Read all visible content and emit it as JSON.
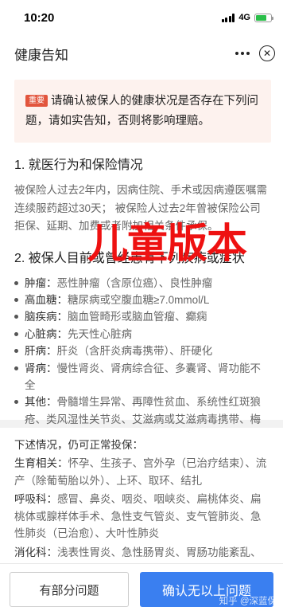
{
  "status": {
    "time": "10:20",
    "network": "4G"
  },
  "nav": {
    "title": "健康告知"
  },
  "notice": {
    "badge": "重要",
    "text": "请确认被保人的健康状况是否存在下列问题，请如实告知，否则将影响理赔。"
  },
  "section1": {
    "title": "1. 就医行为和保险情况",
    "text": "被保险人过去2年内，因病住院、手术或因病遵医嘱需连续服药超过30天； 被保险人过去2年曾被保险公司拒保、延期、加费或者附加相关条件承保。"
  },
  "section2": {
    "title": "2. 被保人目前或曾经患有下列疾病或症状",
    "items": [
      {
        "label": "肿瘤：",
        "text": "恶性肿瘤（含原位癌）、良性肿瘤"
      },
      {
        "label": "高血糖：",
        "text": "糖尿病或空腹血糖≥7.0mmol/L"
      },
      {
        "label": "脑疾病：",
        "text": "脑血管畸形或脑血管瘤、癫痫"
      },
      {
        "label": "心脏病：",
        "text": "先天性心脏病"
      },
      {
        "label": "肝病：",
        "text": "肝炎（含肝炎病毒携带）、肝硬化"
      },
      {
        "label": "肾病：",
        "text": "慢性肾炎、肾病综合征、多囊肾、肾功能不全"
      },
      {
        "label": "其他：",
        "text": "骨髓增生异常、再障性贫血、系统性红斑狼疮、类风湿性关节炎、艾滋病或艾滋病毒携带、梅毒、精神疾病、瘫痪"
      }
    ]
  },
  "overlay_text": "儿童版本",
  "card2": {
    "title": "下述情况，仍可正常投保：",
    "items": [
      {
        "label": "生育相关：",
        "text": "怀孕、生孩子、宫外孕（已治疗结束）、流产（除葡萄胎以外）、上环、取环、结扎"
      },
      {
        "label": "呼吸科：",
        "text": "感冒、鼻炎、咽炎、咽峡炎、扁桃体炎、扁桃体或腺样体手术、急性支气管炎、支气管肺炎、急性肺炎（已治愈）、大叶性肺炎"
      },
      {
        "label": "消化科：",
        "text": "浅表性胃炎、急性肠胃炎、胃肠功能紊乱、急性阑尾炎、胆囊结石或胆囊炎（已切除胆囊）、胆囊息"
      }
    ]
  },
  "footer": {
    "secondary_label": "有部分问题",
    "primary_label": "确认无以上问题"
  },
  "watermark": "知乎 @深蓝保",
  "colors": {
    "primary": "#3a7ff0",
    "badge": "#e2553d",
    "overlay": "#ee1111",
    "notice_bg": "#fdf2ee"
  }
}
